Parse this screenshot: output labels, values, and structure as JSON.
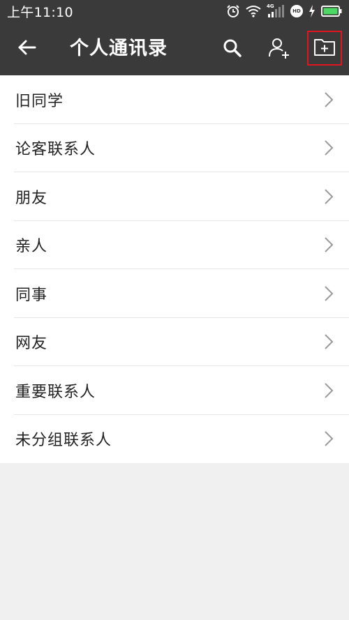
{
  "status_bar": {
    "time": "上午11:10",
    "network_label": "4G",
    "hd_label": "HD"
  },
  "app_bar": {
    "title": "个人通讯录",
    "back_icon": "arrow-left-icon",
    "search_icon": "search-icon",
    "add_contact_icon": "add-person-icon",
    "new_group_icon": "folder-plus-icon"
  },
  "colors": {
    "app_bar_bg": "#3a3a3a",
    "highlight_border": "#e0151f",
    "battery_green": "#4cd964",
    "page_bg": "#f0f0f0"
  },
  "groups": [
    {
      "label": "旧同学"
    },
    {
      "label": "论客联系人"
    },
    {
      "label": "朋友"
    },
    {
      "label": "亲人"
    },
    {
      "label": "同事"
    },
    {
      "label": "网友"
    },
    {
      "label": "重要联系人"
    },
    {
      "label": "未分组联系人"
    }
  ]
}
